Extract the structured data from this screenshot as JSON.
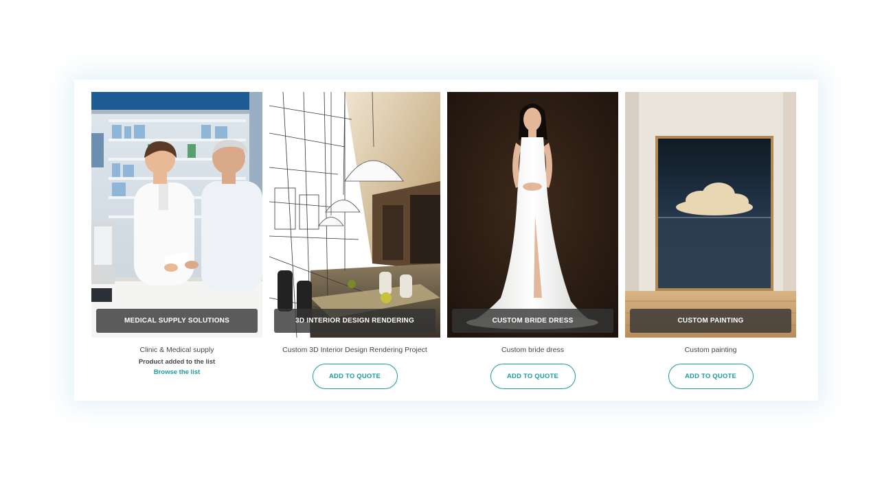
{
  "products": [
    {
      "id": "medical",
      "overlay_label": "MEDICAL SUPPLY SOLUTIONS",
      "title": "Clinic & Medical supply",
      "added_note": "Product added to the list",
      "browse_link": "Browse the list"
    },
    {
      "id": "interior",
      "overlay_label": "3D INTERIOR DESIGN RENDERING",
      "title": "Custom 3D Interior Design Rendering Project",
      "button_label": "ADD TO QUOTE"
    },
    {
      "id": "dress",
      "overlay_label": "CUSTOM BRIDE DRESS",
      "title": "Custom bride dress",
      "button_label": "ADD TO QUOTE"
    },
    {
      "id": "painting",
      "overlay_label": "CUSTOM PAINTING",
      "title": "Custom painting",
      "button_label": "ADD TO QUOTE"
    }
  ],
  "colors": {
    "accent": "#1a9c9c",
    "text": "#444444",
    "overlay": "#343434"
  }
}
